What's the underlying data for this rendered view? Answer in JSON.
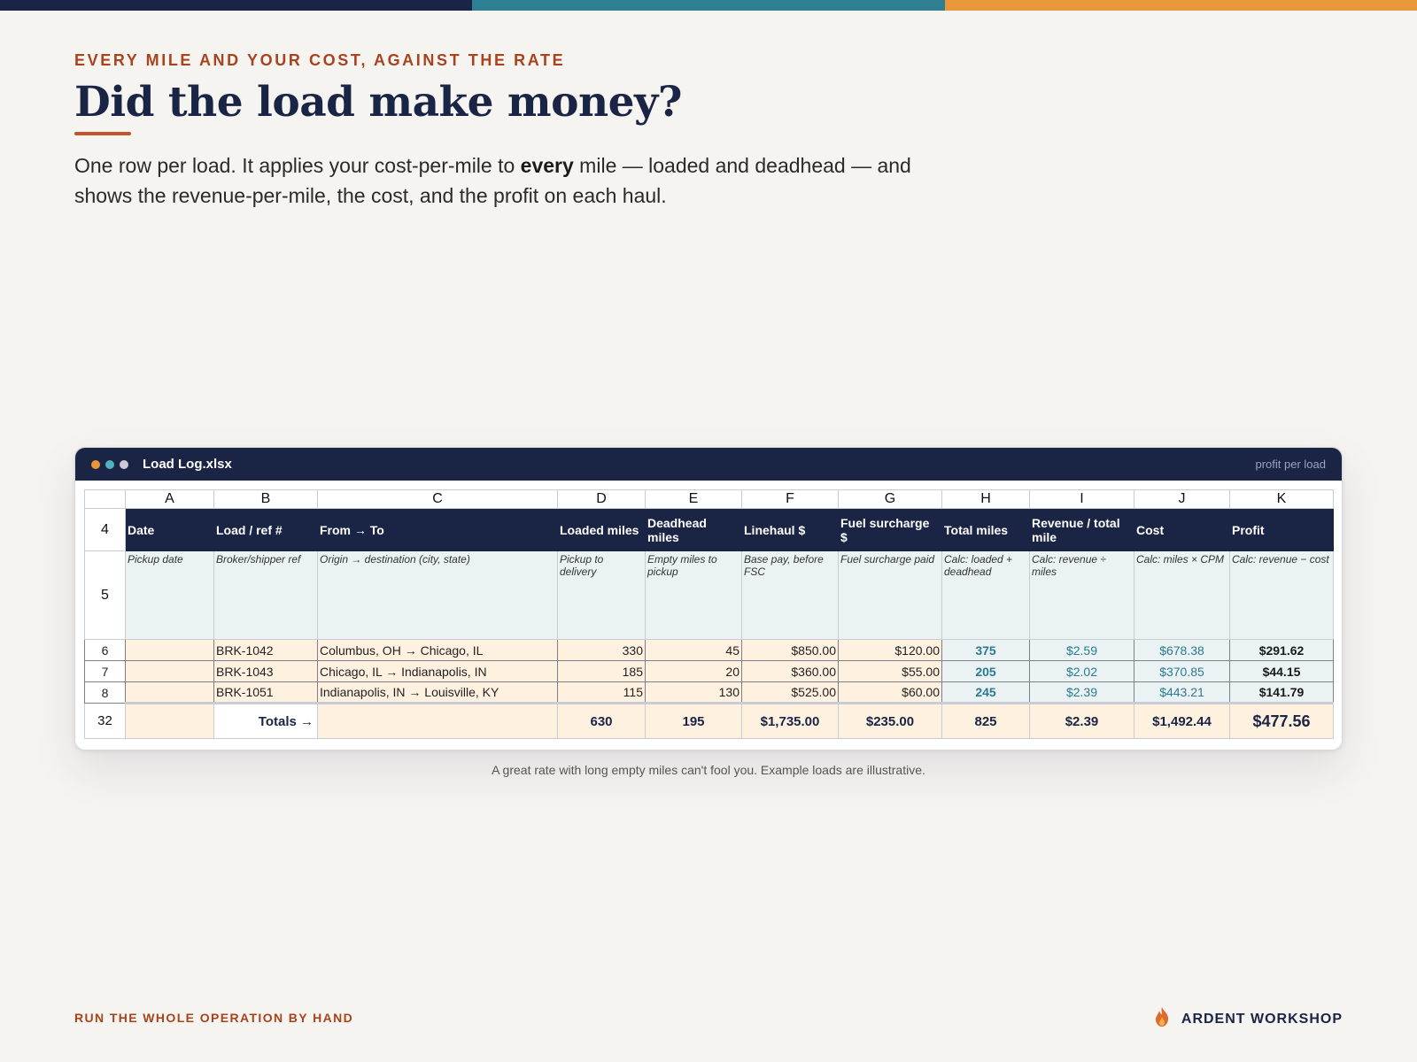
{
  "colors": {
    "navy": "#1a2444",
    "teal": "#2b7a8f",
    "orange": "#e0913a",
    "rust": "#a8431e"
  },
  "header": {
    "eyebrow": "EVERY MILE AND YOUR COST, AGAINST THE RATE",
    "title": "Did the load make money?",
    "lead_pre": "One row per load. It applies your cost-per-mile to ",
    "lead_bold": "every",
    "lead_post": " mile — loaded and deadhead — and shows the revenue-per-mile, the cost, and the profit on each haul."
  },
  "window": {
    "title": "Load Log.xlsx",
    "tag": "profit per load"
  },
  "sheet": {
    "columns": [
      "A",
      "B",
      "C",
      "D",
      "E",
      "F",
      "G",
      "H",
      "I",
      "J",
      "K"
    ],
    "header_row": {
      "num": "4",
      "cells": [
        "Date",
        "Load / ref #",
        "From → To",
        "Loaded miles",
        "Deadhead miles",
        "Linehaul $",
        "Fuel surcharge $",
        "Total miles",
        "Revenue / total mile",
        "Cost",
        "Profit"
      ]
    },
    "hint_row": {
      "num": "5",
      "cells": [
        "Pickup date",
        "Broker/shipper ref",
        "Origin → destination (city, state)",
        "Pickup to delivery",
        "Empty miles to pickup",
        "Base pay, before FSC",
        "Fuel surcharge paid",
        "Calc: loaded + deadhead",
        "Calc: revenue ÷ miles",
        "Calc: miles × CPM",
        "Calc: revenue − cost"
      ]
    },
    "rows": [
      {
        "num": "6",
        "date": "",
        "ref": "BRK-1042",
        "route": "Columbus, OH → Chicago, IL",
        "loaded": "330",
        "deadhead": "45",
        "linehaul": "$850.00",
        "fsc": "$120.00",
        "total": "375",
        "rpm": "$2.59",
        "cost": "$678.38",
        "profit": "$291.62"
      },
      {
        "num": "7",
        "date": "",
        "ref": "BRK-1043",
        "route": "Chicago, IL → Indianapolis, IN",
        "loaded": "185",
        "deadhead": "20",
        "linehaul": "$360.00",
        "fsc": "$55.00",
        "total": "205",
        "rpm": "$2.02",
        "cost": "$370.85",
        "profit": "$44.15"
      },
      {
        "num": "8",
        "date": "",
        "ref": "BRK-1051",
        "route": "Indianapolis, IN → Louisville, KY",
        "loaded": "115",
        "deadhead": "130",
        "linehaul": "$525.00",
        "fsc": "$60.00",
        "total": "245",
        "rpm": "$2.39",
        "cost": "$443.21",
        "profit": "$141.79"
      }
    ],
    "totals": {
      "num": "32",
      "label": "Totals →",
      "loaded": "630",
      "deadhead": "195",
      "linehaul": "$1,735.00",
      "fsc": "$235.00",
      "total": "825",
      "rpm": "$2.39",
      "cost": "$1,492.44",
      "profit": "$477.56"
    }
  },
  "caption": "A great rate with long empty miles can't fool you. Example loads are illustrative.",
  "footer": {
    "left": "RUN THE WHOLE OPERATION BY HAND",
    "brand": "ARDENT WORKSHOP",
    "brand_icon": "flame-icon"
  }
}
